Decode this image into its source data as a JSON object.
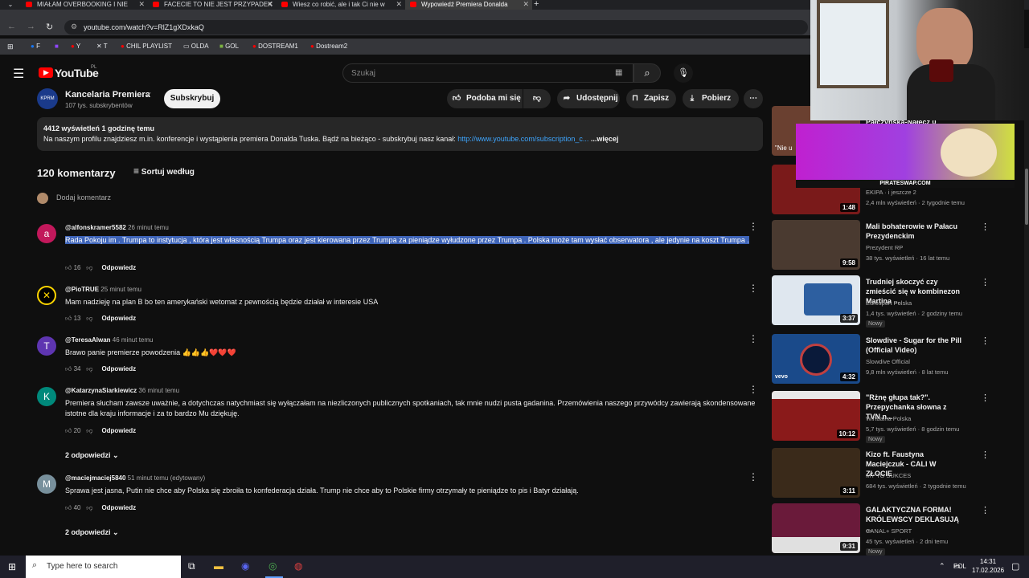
{
  "browser": {
    "tabs": [
      {
        "title": "MIAŁAM OVERBOOKING I NIE"
      },
      {
        "title": "FACECIE TO NIE JEST PRZYPADEK"
      },
      {
        "title": "Wiesz co robić, ale i tak Ci nie w"
      },
      {
        "title": "Wypowiedź Premiera Donalda"
      }
    ],
    "url": "youtube.com/watch?v=RlZ1gXDxkaQ",
    "bookmarks": [
      "F",
      "Y",
      "T",
      "CHIL PLAYLIST",
      "OLDA",
      "GOL",
      "DOSTREAM1",
      "Dostream2"
    ]
  },
  "youtube": {
    "logo": "YouTube",
    "region": "PL",
    "search_placeholder": "Szukaj"
  },
  "channel": {
    "name": "Kancelaria Premiera",
    "subs": "107 tys. subskrybentów",
    "subscribe": "Subskrybuj",
    "like": "Podoba mi się",
    "share": "Udostępnij",
    "save": "Zapisz",
    "download": "Pobierz"
  },
  "description": {
    "meta": "4412 wyświetleń  1 godzinę temu",
    "text": "Na naszym profilu znajdziesz m.in. konferencje i wystąpienia premiera Donalda Tuska. Bądź na bieżąco - subskrybuj nasz kanał:",
    "link": "http://www.youtube.com/subscription_c...",
    "more": "...więcej"
  },
  "comments": {
    "count": "120 komentarzy",
    "sort": "Sortuj według",
    "add": "Dodaj komentarz",
    "reply_label": "Odpowiedz",
    "items": [
      {
        "author": "@alfonskramer5582",
        "time": "26 minut temu",
        "text": "Rada Pokoju im . Trumpa to instytucja , która jest własnością Trumpa  oraz jest kierowana przez Trumpa  za pieniądze wyłudzone przez Trumpa  .  Polska może tam  wysłać  obserwatora  , ale jedynie na koszt Trumpa  .",
        "likes": "16",
        "avatar": "a",
        "color": "#c2185b"
      },
      {
        "author": "@PioTRUE",
        "time": "25 minut temu",
        "text": "Mam nadzieję na plan B bo ten amerykański wetomat z pewnością będzie działał w interesie USA",
        "likes": "13",
        "avatar": "✕",
        "color": "#000000"
      },
      {
        "author": "@TeresaAlwan",
        "time": "46 minut temu",
        "text": "Brawo panie premierze powodzenia 👍👍👍❤️❤️❤️",
        "likes": "34",
        "avatar": "T",
        "color": "#5e35b1"
      },
      {
        "author": "@KatarzynaSiarkiewicz",
        "time": "36 minut temu",
        "text": "Premiera słucham zawsze  uważnie, a dotychczas  natychmiast się wyłączałam na niezliczonych publicznych spotkaniach, tak mnie nudzi pusta gadanina. Przemówienia naszego przywódcy zawierają skondensowane istotne dla kraju informacje i za to bardzo Mu dziękuję.",
        "likes": "20",
        "avatar": "K",
        "color": "#00897b",
        "replies": "2 odpowiedzi"
      },
      {
        "author": "@maciejmaciej5840",
        "time": "51 minut temu (edytowany)",
        "text": "Sprawa jest jasna, Putin nie chce aby Polska się zbroiła to konfederacja działa. Trump nie chce aby to Polskie firmy otrzymały te pieniądze to pis i Batyr działają.",
        "likes": "40",
        "avatar": "M",
        "color": "#78909c",
        "replies": "2 odpowiedzi"
      }
    ]
  },
  "recommended": [
    {
      "title": "",
      "channel": "EKIPA · i jeszcze 2",
      "meta": "2,4 mln wyświetleń · 2 tygodnie temu",
      "duration": "1:48",
      "nowy": "",
      "thumb": "#7a1a1a"
    },
    {
      "title": "Mali bohaterowie w Pałacu Prezydenckim",
      "channel": "Prezydent RP",
      "meta": "38 tys. wyświetleń · 16 lat temu",
      "duration": "9:58",
      "nowy": "",
      "thumb": "#4a3a30"
    },
    {
      "title": "Trudniej skoczyć czy zmieścić się w kombinezon Martina ...",
      "channel": "Eurosport Polska",
      "meta": "1,4 tys. wyświetleń · 2 godziny temu",
      "duration": "3:37",
      "nowy": "Nowy",
      "thumb": "#2d5fa0"
    },
    {
      "title": "Slowdive - Sugar for the Pill (Official Video)",
      "channel": "Slowdive Official",
      "meta": "9,8 mln wyświetleń · 8 lat temu",
      "duration": "4:32",
      "nowy": "",
      "thumb": "#1a4a8a"
    },
    {
      "title": "\"Rżnę głupa tak?\". Przepychanka słowna z TVN n...",
      "channel": "Wirtualna Polska",
      "meta": "5,7 tys. wyświetleń · 8 godzin temu",
      "duration": "10:12",
      "nowy": "Nowy",
      "thumb": "#8a1a1a"
    },
    {
      "title": "Kizo ft. Faustyna Maciejczuk - CALI W ZŁOCIE",
      "channel": "MY TO SUKCES",
      "meta": "684 tys. wyświetleń · 2 tygodnie temu",
      "duration": "3:11",
      "nowy": "",
      "thumb": "#3a2a1a"
    },
    {
      "title": "GALAKTYCZNA FORMA! KRÓLEWSCY DEKLASUJĄ ...",
      "channel": "CANAL+ SPORT",
      "meta": "45 tys. wyświetleń · 2 dni temu",
      "duration": "9:31",
      "nowy": "Nowy",
      "thumb": "#6a1a3a"
    }
  ],
  "overlay": {
    "rec0_title_partial": "Pałczyńska-Nałęcz 0",
    "rec0_snippet": "\"Nie u",
    "pirate": "PIRATESWAP.COM"
  },
  "taskbar": {
    "search": "Type here to search",
    "lang": "POL",
    "time": "14:31",
    "date": "17.02.2026"
  }
}
